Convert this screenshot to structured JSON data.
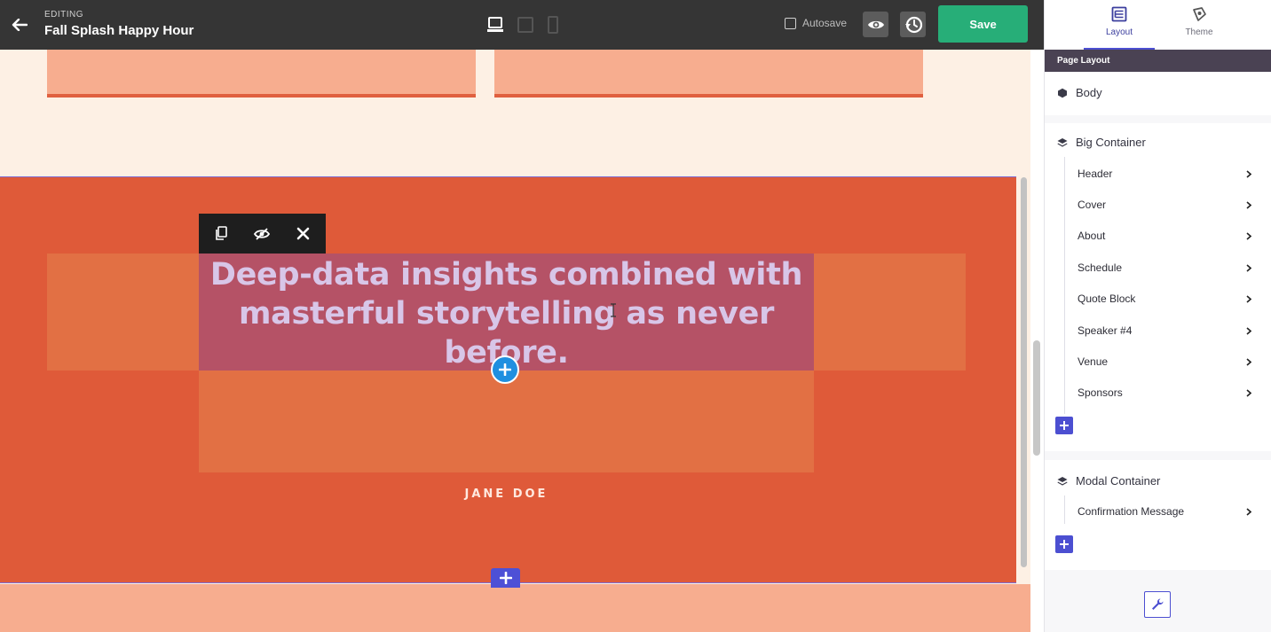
{
  "header": {
    "editing_label": "EDITING",
    "title": "Fall Splash Happy Hour",
    "autosave_label": "Autosave",
    "autosave_checked": false,
    "save_label": "Save",
    "icons": [
      "back-arrow-icon",
      "desktop-icon",
      "tablet-icon",
      "mobile-icon",
      "eye-icon",
      "history-icon"
    ]
  },
  "canvas": {
    "quote_text": "Deep-data insights combined with masterful storytelling as never before.",
    "speaker_name": "JANE DOE",
    "colors": {
      "section_bg": "#df5a39",
      "panel_bg": "#e27044",
      "selected_text_bg": "#b55266",
      "quote_text": "#d8c6e8",
      "card_bg": "#f7ad8f",
      "page_bg": "#fdf0e4"
    }
  },
  "element_toolbar": {
    "icons": [
      "duplicate-icon",
      "hide-icon",
      "close-icon"
    ]
  },
  "panel": {
    "tabs": [
      {
        "label": "Layout",
        "icon": "layout-icon",
        "active": true
      },
      {
        "label": "Theme",
        "icon": "theme-icon",
        "active": false
      }
    ],
    "section_title": "Page Layout",
    "body_label": "Body",
    "big_container": {
      "label": "Big Container",
      "items": [
        "Header",
        "Cover",
        "About",
        "Schedule",
        "Quote Block",
        "Speaker #4",
        "Venue",
        "Sponsors"
      ]
    },
    "modal_container": {
      "label": "Modal Container",
      "items": [
        "Confirmation Message"
      ]
    },
    "accent": "#4c4fd1"
  }
}
